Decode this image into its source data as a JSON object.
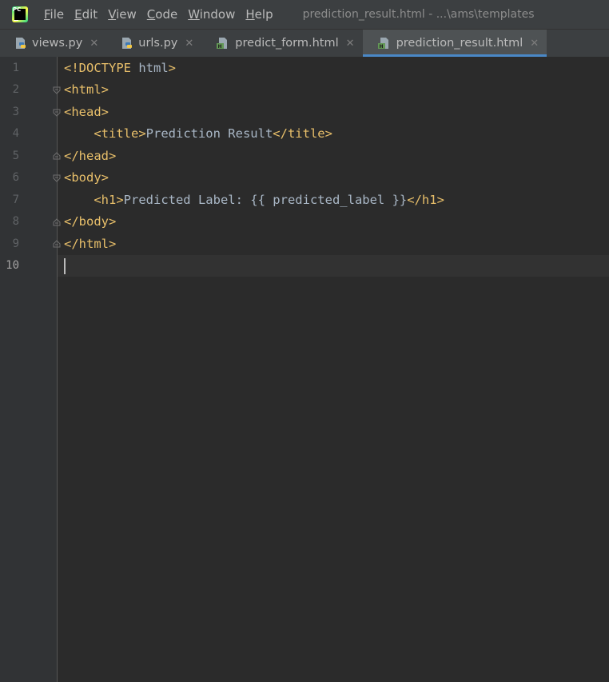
{
  "menu": {
    "items": [
      {
        "label": "File",
        "mnemonic": "F",
        "rest": "ile"
      },
      {
        "label": "Edit",
        "mnemonic": "E",
        "rest": "dit"
      },
      {
        "label": "View",
        "mnemonic": "V",
        "rest": "iew"
      },
      {
        "label": "Code",
        "mnemonic": "C",
        "rest": "ode"
      },
      {
        "label": "Window",
        "mnemonic": "W",
        "rest": "indow"
      },
      {
        "label": "Help",
        "mnemonic": "H",
        "rest": "elp"
      }
    ]
  },
  "window_title": "prediction_result.html - ...\\ams\\templates",
  "tabs": [
    {
      "label": "views.py",
      "icon": "python-file-icon",
      "active": false
    },
    {
      "label": "urls.py",
      "icon": "python-file-icon",
      "active": false
    },
    {
      "label": "predict_form.html",
      "icon": "html-file-icon",
      "active": false
    },
    {
      "label": "prediction_result.html",
      "icon": "html-file-icon",
      "active": true
    }
  ],
  "close_glyph": "✕",
  "editor": {
    "line_numbers": [
      "1",
      "2",
      "3",
      "4",
      "5",
      "6",
      "7",
      "8",
      "9",
      "10"
    ],
    "current_line": "10",
    "lines": [
      {
        "tag1": "<!DOCTYPE",
        "text": " html",
        "tag2": ">"
      },
      {
        "tag1": "<html>",
        "text": "",
        "tag2": ""
      },
      {
        "tag1": "<head>",
        "text": "",
        "tag2": ""
      },
      {
        "tag1": "    <title>",
        "text": "Prediction Result",
        "tag2": "</title>"
      },
      {
        "tag1": "</head>",
        "text": "",
        "tag2": ""
      },
      {
        "tag1": "<body>",
        "text": "",
        "tag2": ""
      },
      {
        "tag1": "    <h1>",
        "text": "Predicted Label: {{ predicted_label }}",
        "tag2": "</h1>"
      },
      {
        "tag1": "</body>",
        "text": "",
        "tag2": ""
      },
      {
        "tag1": "</html>",
        "text": "",
        "tag2": ""
      },
      {
        "tag1": "",
        "text": "",
        "tag2": ""
      }
    ]
  },
  "colors": {
    "background": "#2b2b2b",
    "tag": "#e8bf6a",
    "text": "#a9b7c6",
    "active_tab_underline": "#4a88c7"
  }
}
